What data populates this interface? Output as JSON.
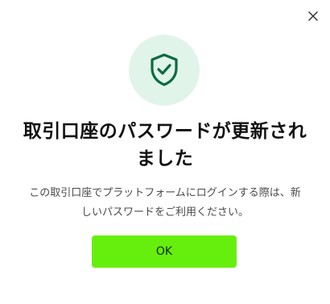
{
  "dialog": {
    "close_icon": "close-icon",
    "badge_icon": "shield-check-icon",
    "title_line1": "取引口座のパスワードが更新され",
    "title_line2": "ました",
    "message_line1": "この取引口座でプラットフォームにログインする際は、新",
    "message_line2": "しいパスワードをご利用ください。",
    "ok_label": "OK"
  },
  "colors": {
    "accent_button": "#66ef0c",
    "icon_green": "#0b6b3f",
    "badge_bg": "#e1f4ea"
  }
}
